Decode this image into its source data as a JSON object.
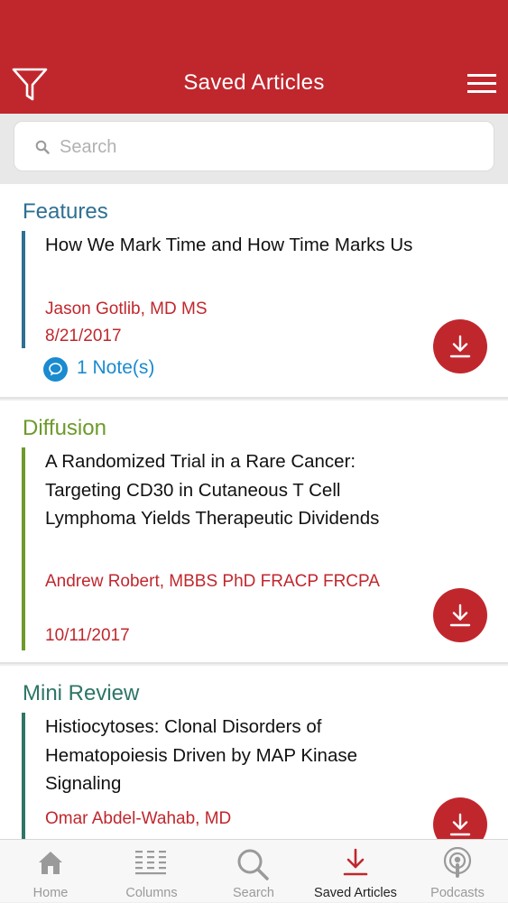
{
  "header": {
    "title": "Saved Articles",
    "filter_icon": "filter-funnel-icon",
    "menu_icon": "hamburger-menu-icon"
  },
  "search": {
    "placeholder": "Search",
    "icon": "search-icon"
  },
  "articles": [
    {
      "category": "Features",
      "category_color": "#2e6f92",
      "title": "How We Mark Time and How Time Marks Us",
      "author": "Jason Gotlib, MD MS",
      "date": "8/21/2017",
      "notes": "1 Note(s)"
    },
    {
      "category": "Diffusion",
      "category_color": "#6d9a2b",
      "title": "A Randomized Trial in a Rare Cancer: Targeting CD30 in Cutaneous T Cell Lymphoma Yields Therapeutic Dividends",
      "author": "Andrew Robert, MBBS PhD FRACP FRCPA",
      "date": "10/11/2017"
    },
    {
      "category": "Mini Review",
      "category_color": "#2e7566",
      "title": "Histiocytoses: Clonal Disorders of Hematopoiesis Driven by MAP Kinase Signaling",
      "author": "Omar Abdel-Wahab, MD"
    }
  ],
  "colors": {
    "brand_red": "#c0272d",
    "notes_blue": "#1a8bd0"
  },
  "tabs": [
    {
      "label": "Home",
      "icon": "home-icon"
    },
    {
      "label": "Columns",
      "icon": "columns-icon"
    },
    {
      "label": "Search",
      "icon": "search-icon"
    },
    {
      "label": "Saved Articles",
      "icon": "download-icon",
      "active": true
    },
    {
      "label": "Podcasts",
      "icon": "podcast-icon"
    }
  ]
}
